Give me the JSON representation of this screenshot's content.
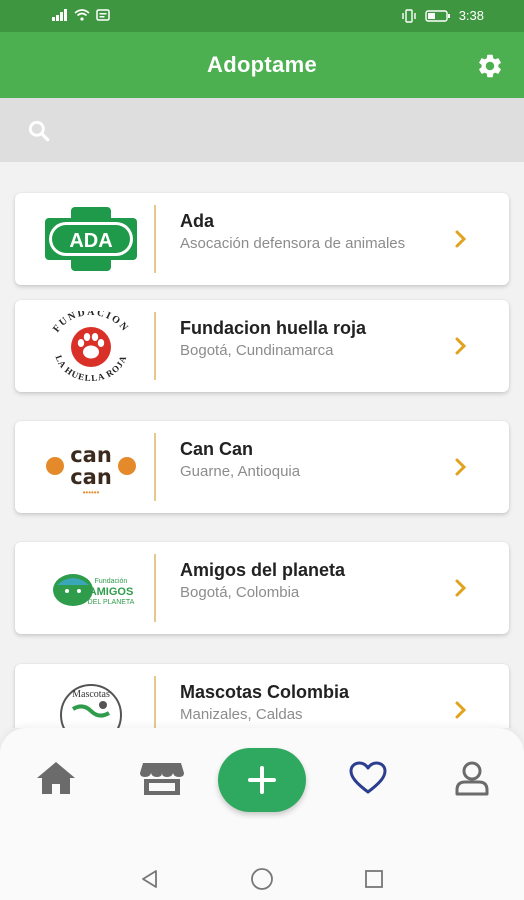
{
  "status_bar": {
    "time": "3:38"
  },
  "app_bar": {
    "title": "Adoptame",
    "settings_icon": "gear-icon"
  },
  "search": {
    "value": "",
    "placeholder": ""
  },
  "organizations": [
    {
      "name": "Ada",
      "subtitle": "Asocación defensora de animales",
      "logo_text": "ADA"
    },
    {
      "name": "Fundacion huella roja",
      "subtitle": "Bogotá, Cundinamarca",
      "logo_text": "FUNDACION LA HUELLA ROJA"
    },
    {
      "name": "Can Can",
      "subtitle": "Guarne, Antioquia",
      "logo_text": "can can"
    },
    {
      "name": "Amigos del planeta",
      "subtitle": "Bogotá, Colombia",
      "logo_text": "AMIGOS DEL PLANETA"
    },
    {
      "name": "Mascotas Colombia",
      "subtitle": "Manizales, Caldas",
      "logo_text": "Mascotas"
    }
  ],
  "bottom_nav": {
    "items": [
      "home-icon",
      "store-icon",
      "add-icon",
      "heart-icon",
      "user-icon"
    ],
    "active": "heart-icon"
  },
  "colors": {
    "primary": "#4caf50",
    "status_bar": "#3e9640",
    "fab": "#2fa860",
    "accent": "#e0a21f",
    "active_nav": "#2c3e8f"
  }
}
